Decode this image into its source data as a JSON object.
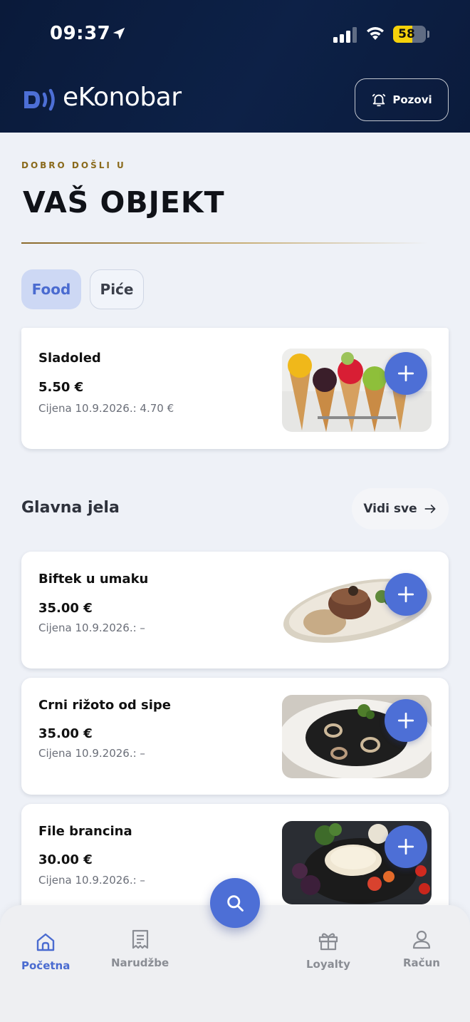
{
  "status_bar": {
    "time": "09:37",
    "battery": "58",
    "battery_level": 0.58
  },
  "header": {
    "app_name": "eKonobar",
    "call_label": "Pozovi"
  },
  "intro": {
    "welcome": "DOBRO DOŠLI U",
    "venue": "VAŠ OBJEKT"
  },
  "tabs": [
    {
      "label": "Food",
      "active": true
    },
    {
      "label": "Piće",
      "active": false
    }
  ],
  "featured": {
    "name": "Sladoled",
    "price": "5.50 €",
    "old_price": "Cijena 10.9.2026.: 4.70 €"
  },
  "section": {
    "title": "Glavna jela",
    "view_all": "Vidi sve"
  },
  "items": [
    {
      "name": "Biftek u umaku",
      "price": "35.00 €",
      "old_price": "Cijena 10.9.2026.: –"
    },
    {
      "name": "Crni rižoto od sipe",
      "price": "35.00 €",
      "old_price": "Cijena 10.9.2026.: –"
    },
    {
      "name": "File brancina",
      "price": "30.00 €",
      "old_price": "Cijena 10.9.2026.: –"
    }
  ],
  "nav": [
    {
      "label": "Početna",
      "icon": "home-icon",
      "active": true
    },
    {
      "label": "Narudžbe",
      "icon": "receipt-icon",
      "active": false
    },
    {
      "label": "Loyalty",
      "icon": "gift-icon",
      "active": false
    },
    {
      "label": "Račun",
      "icon": "user-icon",
      "active": false
    }
  ],
  "colors": {
    "brand": "#0d2147",
    "accent": "#4d6fd6",
    "gold": "#8a6a1c"
  }
}
